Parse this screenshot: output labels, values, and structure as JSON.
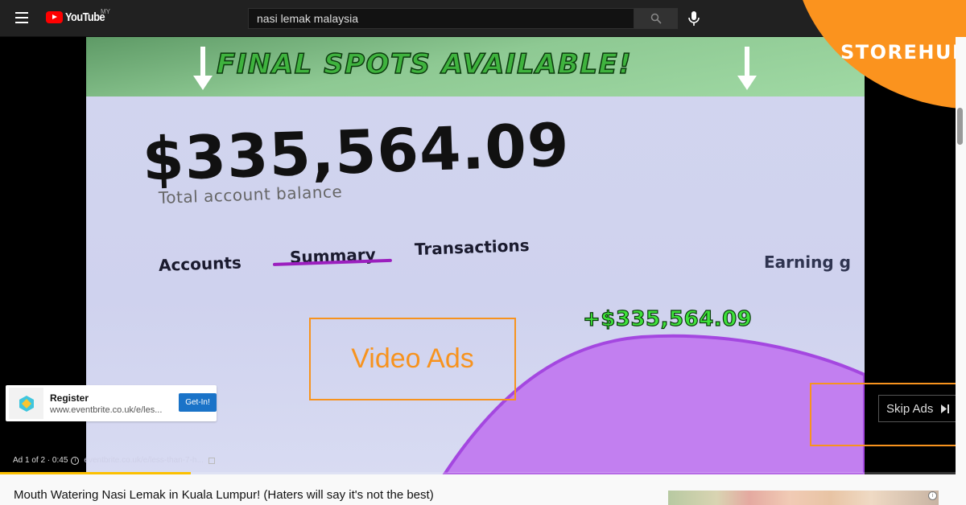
{
  "header": {
    "logo_text": "YouTube",
    "logo_region": "MY",
    "search_value": "nasi lemak malaysia"
  },
  "video_ad": {
    "banner_text": "FINAL SPOTS AVAILABLE!",
    "balance_amount": "$335,564.09",
    "balance_label": "Total account balance",
    "tabs": [
      "Accounts",
      "Summary",
      "Transactions"
    ],
    "active_tab": "Summary",
    "earning_label": "Earning g",
    "gain_amount": "+$335,564.09",
    "brand_overlay": "STOREHUB",
    "brand_color": "#fb931e"
  },
  "annotations": {
    "video_ads_label": "Video Ads",
    "color": "#f7931e"
  },
  "skip_button": {
    "label": "Skip Ads"
  },
  "cta_card": {
    "title": "Register",
    "url": "www.eventbrite.co.uk/e/les...",
    "button_label": "Get-In!"
  },
  "ad_info": {
    "position": "Ad 1 of 2 · 0:45",
    "url": "eventbrite.co.uk/e/less-than-7-h...",
    "progress_percent": 20,
    "progress_color": "#fcc000"
  },
  "below_player": {
    "video_title": "Mouth Watering Nasi Lemak in Kuala Lumpur! (Haters will say it's not the best)"
  }
}
